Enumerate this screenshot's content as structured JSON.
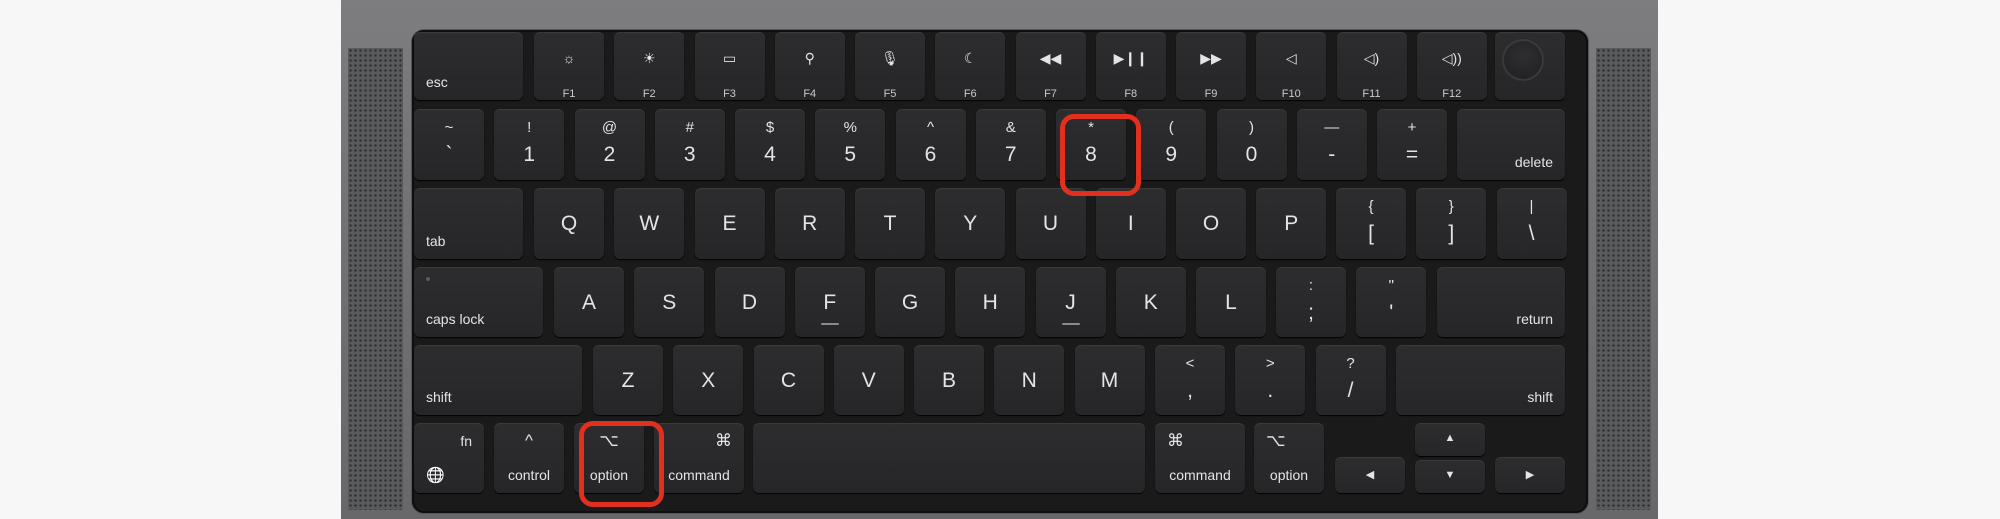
{
  "colors": {
    "highlight": "#e2301f",
    "key": "#2a2a2c",
    "deck": "#1a1a1b",
    "chassis": "#707073"
  },
  "function_row": {
    "esc": "esc",
    "keys": [
      {
        "icon": "brightness-down-icon",
        "glyph": "☼",
        "label": "F1"
      },
      {
        "icon": "brightness-up-icon",
        "glyph": "☀",
        "label": "F2"
      },
      {
        "icon": "mission-control-icon",
        "glyph": "▭",
        "label": "F3"
      },
      {
        "icon": "spotlight-search-icon",
        "glyph": "⚲",
        "label": "F4"
      },
      {
        "icon": "dictation-icon",
        "glyph": "🎙",
        "label": "F5"
      },
      {
        "icon": "do-not-disturb-icon",
        "glyph": "☾",
        "label": "F6"
      },
      {
        "icon": "rewind-icon",
        "glyph": "◀◀",
        "label": "F7"
      },
      {
        "icon": "play-pause-icon",
        "glyph": "▶❙❙",
        "label": "F8"
      },
      {
        "icon": "fast-forward-icon",
        "glyph": "▶▶",
        "label": "F9"
      },
      {
        "icon": "mute-icon",
        "glyph": "◁",
        "label": "F10"
      },
      {
        "icon": "volume-down-icon",
        "glyph": "◁)",
        "label": "F11"
      },
      {
        "icon": "volume-up-icon",
        "glyph": "◁))",
        "label": "F12"
      }
    ]
  },
  "number_row": {
    "keys": [
      {
        "top": "~",
        "bottom": "`"
      },
      {
        "top": "!",
        "bottom": "1"
      },
      {
        "top": "@",
        "bottom": "2"
      },
      {
        "top": "#",
        "bottom": "3"
      },
      {
        "top": "$",
        "bottom": "4"
      },
      {
        "top": "%",
        "bottom": "5"
      },
      {
        "top": "^",
        "bottom": "6"
      },
      {
        "top": "&",
        "bottom": "7"
      },
      {
        "top": "*",
        "bottom": "8"
      },
      {
        "top": "(",
        "bottom": "9"
      },
      {
        "top": ")",
        "bottom": "0"
      },
      {
        "top": "—",
        "bottom": "-"
      },
      {
        "top": "+",
        "bottom": "="
      }
    ],
    "delete": "delete"
  },
  "qwerty_row": {
    "tab": "tab",
    "letters": [
      "Q",
      "W",
      "E",
      "R",
      "T",
      "Y",
      "U",
      "I",
      "O",
      "P"
    ],
    "brackets": [
      {
        "top": "{",
        "bottom": "["
      },
      {
        "top": "}",
        "bottom": "]"
      },
      {
        "top": "|",
        "bottom": "\\"
      }
    ]
  },
  "home_row": {
    "caps": "caps lock",
    "letters": [
      "A",
      "S",
      "D",
      "F",
      "G",
      "H",
      "J",
      "K",
      "L"
    ],
    "punct": [
      {
        "top": ":",
        "bottom": ";"
      },
      {
        "top": "\"",
        "bottom": "'"
      }
    ],
    "return": "return"
  },
  "shift_row": {
    "shift_left": "shift",
    "letters": [
      "Z",
      "X",
      "C",
      "V",
      "B",
      "N",
      "M"
    ],
    "punct": [
      {
        "top": "<",
        "bottom": ","
      },
      {
        "top": ">",
        "bottom": "."
      },
      {
        "top": "?",
        "bottom": "/"
      }
    ],
    "shift_right": "shift"
  },
  "bottom_row": {
    "fn": "fn",
    "globe": "🌐",
    "control": {
      "glyph": "^",
      "label": "control"
    },
    "option_left": {
      "glyph": "⌥",
      "label": "option"
    },
    "command_left": {
      "glyph": "⌘",
      "label": "command"
    },
    "command_right": {
      "glyph": "⌘",
      "label": "command"
    },
    "option_right": {
      "glyph": "⌥",
      "label": "option"
    },
    "arrows": {
      "left": "◀",
      "up": "▲",
      "down": "▼",
      "right": "▶"
    }
  },
  "highlighted_keys": [
    "8",
    "option"
  ]
}
